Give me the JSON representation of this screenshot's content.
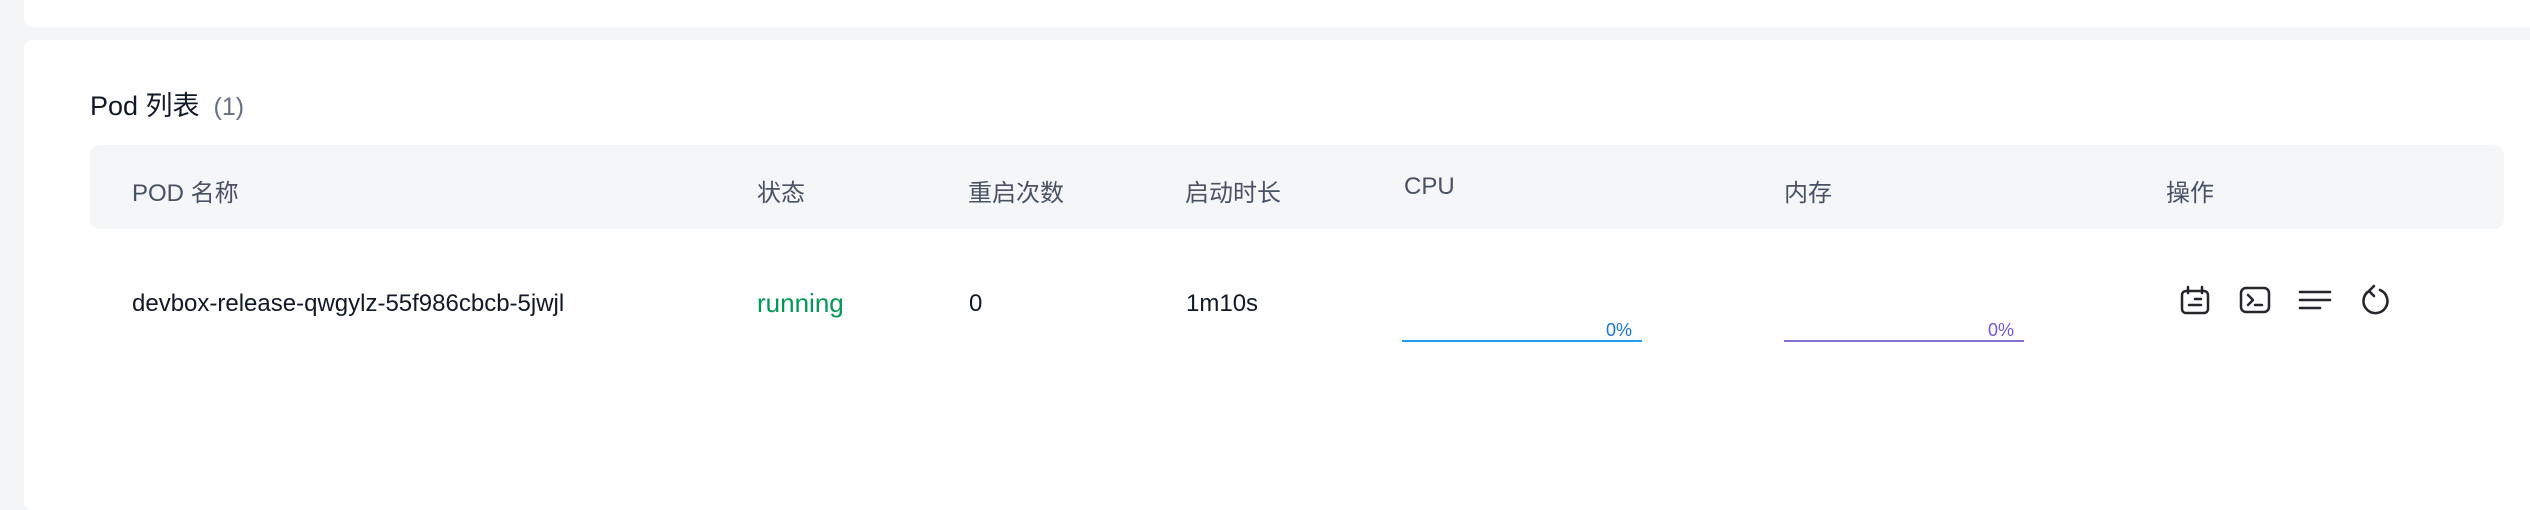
{
  "pod_list": {
    "title": "Pod 列表",
    "count": "(1)"
  },
  "table": {
    "headers": {
      "name": "POD 名称",
      "status": "状态",
      "restarts": "重启次数",
      "uptime": "启动时长",
      "cpu": "CPU",
      "memory": "内存",
      "actions": "操作"
    },
    "rows": [
      {
        "name": "devbox-release-qwgylz-55f986cbcb-5jwjl",
        "status": "running",
        "restarts": "0",
        "uptime": "1m10s",
        "cpu_label": "0%",
        "cpu_fraction": 0,
        "memory_label": "0%",
        "memory_fraction": 0
      }
    ]
  },
  "actions": {
    "icons": [
      "calendar-detail-icon",
      "terminal-icon",
      "logs-icon",
      "restart-icon"
    ]
  },
  "colors": {
    "status_running": "#039855",
    "cpu_bar": "#219bf4",
    "memory_bar": "#8172d8",
    "header_bg": "#f4f6f8"
  }
}
